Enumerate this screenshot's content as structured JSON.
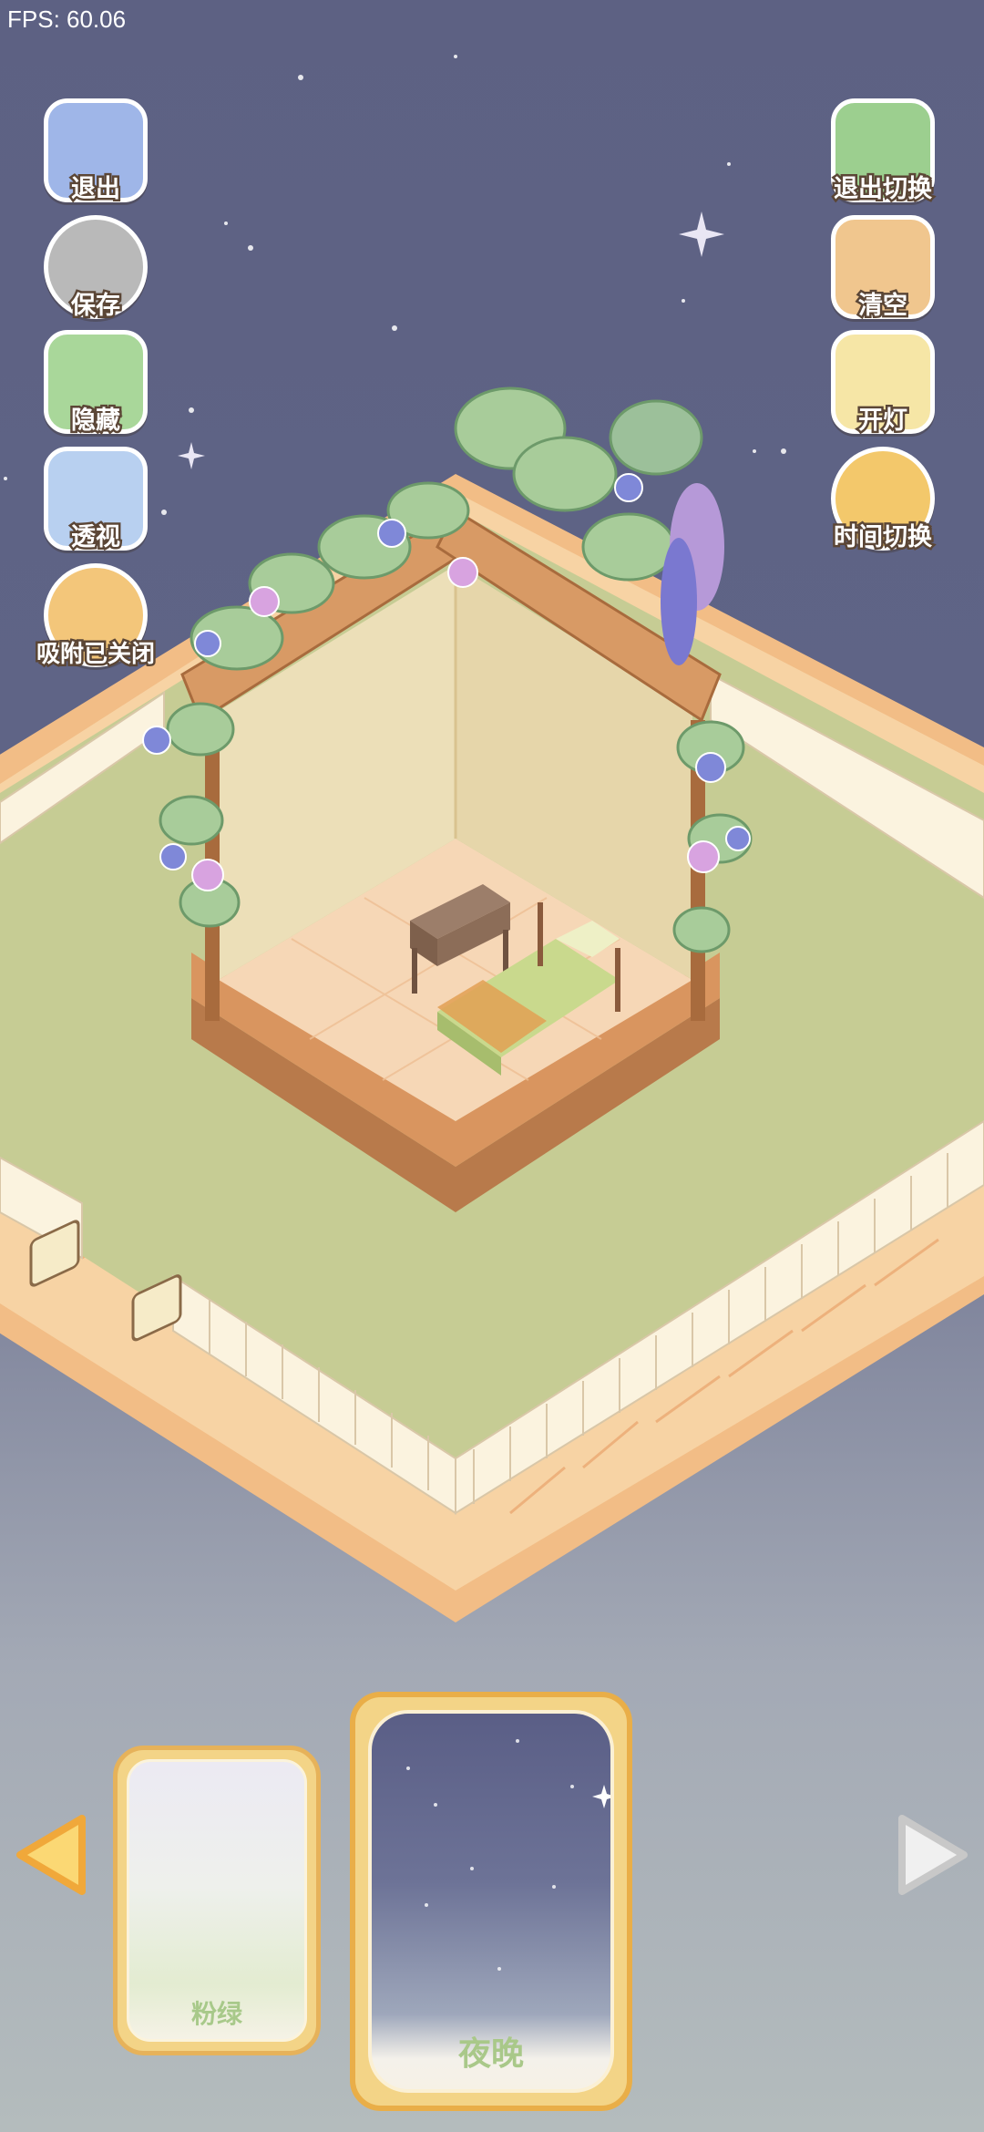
{
  "fps_text": "FPS: 60.06",
  "left_toolbar": [
    {
      "label": "退出",
      "icon": "exit-door-icon",
      "color": "#9fb6e8"
    },
    {
      "label": "保存",
      "icon": "save-hamster-icon",
      "color": "#b9b9b9"
    },
    {
      "label": "隐藏",
      "icon": "hide-frame-icon",
      "color": "#a9d79a"
    },
    {
      "label": "透视",
      "icon": "perspective-cube-icon",
      "color": "#b8d0f0"
    },
    {
      "label": "吸附已关闭",
      "icon": "snap-ducks-icon",
      "color": "#f3c67a"
    }
  ],
  "right_toolbar": [
    {
      "label": "退出切换",
      "icon": "exit-switch-icon",
      "color": "#9ccf8f"
    },
    {
      "label": "清空",
      "icon": "clear-box-icon",
      "color": "#f0c68e"
    },
    {
      "label": "开灯",
      "icon": "lamp-icon",
      "color": "#f6e6a6"
    },
    {
      "label": "时间切换",
      "icon": "time-switch-icon",
      "color": "#f3c86b"
    }
  ],
  "themes": [
    {
      "name": "粉绿",
      "selected": false
    },
    {
      "name": "夜晚",
      "selected": true
    }
  ],
  "colors": {
    "sky_top": "#5d6183",
    "lawn": "#c6cc94",
    "fence": "#fbf3df",
    "path": "#f6cf99",
    "accent_arrow": "#f7c154"
  }
}
